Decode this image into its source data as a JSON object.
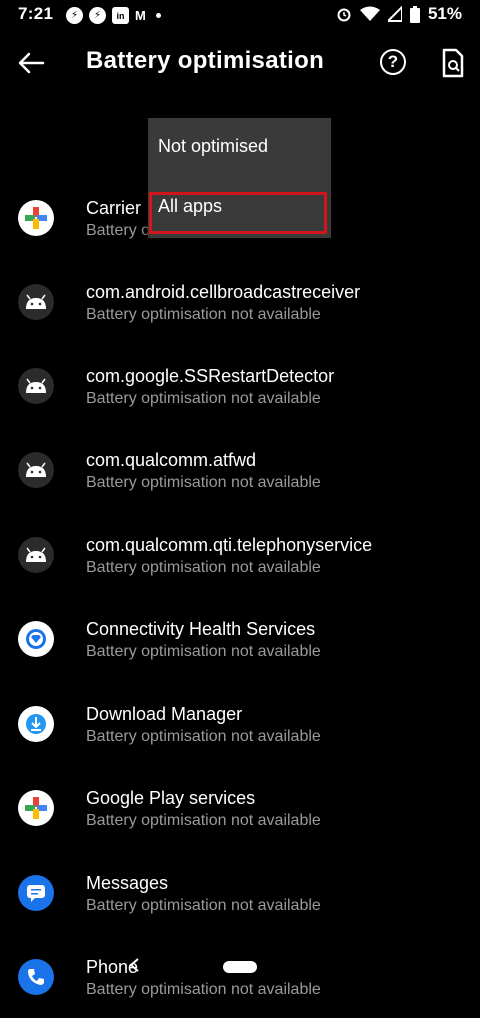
{
  "status": {
    "time": "7:21",
    "battery": "51%",
    "notif_icons": [
      "messenger-icon",
      "messenger-icon",
      "linkedin-icon",
      "gmail-icon"
    ]
  },
  "appbar": {
    "title": "Battery optimisation",
    "help_glyph": "?"
  },
  "dropdown": {
    "options": [
      "Not optimised",
      "All apps"
    ],
    "selected": "All apps"
  },
  "apps": [
    {
      "name": "Carrier",
      "sub": "Battery optimisation not available",
      "icon": "carrier-services-icon"
    },
    {
      "name": "com.android.cellbroadcastreceiver",
      "sub": "Battery optimisation not available",
      "icon": "android-icon"
    },
    {
      "name": "com.google.SSRestartDetector",
      "sub": "Battery optimisation not available",
      "icon": "android-icon"
    },
    {
      "name": "com.qualcomm.atfwd",
      "sub": "Battery optimisation not available",
      "icon": "android-icon"
    },
    {
      "name": "com.qualcomm.qti.telephonyservice",
      "sub": "Battery optimisation not available",
      "icon": "android-icon"
    },
    {
      "name": "Connectivity Health Services",
      "sub": "Battery optimisation not available",
      "icon": "connectivity-health-icon"
    },
    {
      "name": "Download Manager",
      "sub": "Battery optimisation not available",
      "icon": "download-manager-icon"
    },
    {
      "name": "Google Play services",
      "sub": "Battery optimisation not available",
      "icon": "play-services-icon"
    },
    {
      "name": "Messages",
      "sub": "Battery optimisation not available",
      "icon": "messages-icon"
    },
    {
      "name": "Phone",
      "sub": "Battery optimisation not available",
      "icon": "phone-icon"
    }
  ],
  "colors": {
    "background": "#000000",
    "highlight": "#d0161c",
    "dropdown_bg": "#3a3a3a"
  }
}
